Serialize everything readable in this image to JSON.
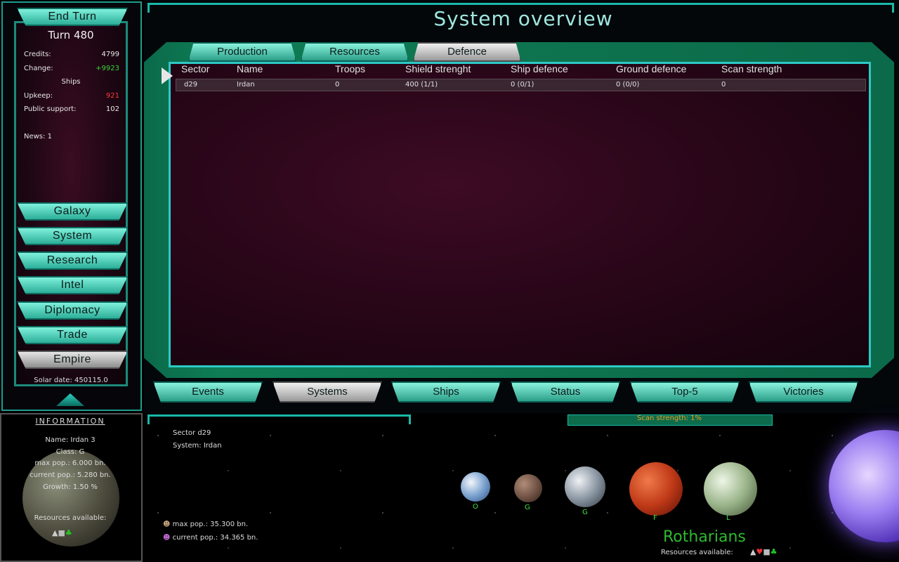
{
  "sidebar": {
    "end_turn": "End Turn",
    "turn": "Turn 480",
    "stats": [
      {
        "label": "Credits:",
        "value": "4799",
        "color": "#e8e8e8"
      },
      {
        "label": "Change:",
        "value": "+9923",
        "color": "#39d439"
      },
      {
        "label": "Upkeep:",
        "value": "921",
        "color": "#ff3a3a"
      },
      {
        "label": "Public support:",
        "value": "102",
        "color": "#e8e8e8"
      }
    ],
    "ships_label": "Ships",
    "news": "News: 1",
    "nav": [
      "Galaxy",
      "System",
      "Research",
      "Intel",
      "Diplomacy",
      "Trade",
      "Empire"
    ],
    "active_nav": "Empire",
    "solar_date": "Solar date: 450115.0"
  },
  "header": {
    "title": "System overview"
  },
  "tabs": {
    "items": [
      "Production",
      "Resources",
      "Defence"
    ],
    "active": "Defence"
  },
  "table": {
    "columns": [
      "Sector",
      "Name",
      "Troops",
      "Shield strenght",
      "Ship defence",
      "Ground defence",
      "Scan strength"
    ],
    "rows": [
      [
        "d29",
        "Irdan",
        "0",
        "400 (1/1)",
        "0 (0/1)",
        "0 (0/0)",
        "0"
      ]
    ]
  },
  "bottom_tabs": {
    "items": [
      "Events",
      "Systems",
      "Ships",
      "Status",
      "Top-5",
      "Victories"
    ],
    "active": "Systems"
  },
  "info": {
    "title": "INFORMATION",
    "lines": [
      "Name: Irdan 3",
      "Class: G",
      "max pop.: 6.000 bn.",
      "current pop.: 5.280 bn.",
      "Growth: 1.50 %"
    ],
    "resources_label": "Resources available:"
  },
  "system_view": {
    "scan_strength": "Scan strength: 1%",
    "sector": "Sector d29",
    "system": "System: Irdan",
    "max_pop": "max pop.: 35.300 bn.",
    "current_pop": "current pop.: 34.365 bn.",
    "race": "Rotharians",
    "resources_label": "Resources available:",
    "planets": [
      {
        "class": "O",
        "color": "#cfd8e6",
        "accent": "#3b6fb0"
      },
      {
        "class": "G",
        "color": "#8a6a5a",
        "accent": "#5a3f34"
      },
      {
        "class": "G",
        "color": "#cfd3d8",
        "accent": "#4a5560"
      },
      {
        "class": "F",
        "color": "#d2461e",
        "accent": "#7a1a0a"
      },
      {
        "class": "L",
        "color": "#cfe0c0",
        "accent": "#6c8a5a"
      }
    ]
  },
  "colors": {
    "accent": "#2ec8c6",
    "frame": "#0f7d55",
    "text_green": "#43e143",
    "scan": "#e8a020"
  }
}
